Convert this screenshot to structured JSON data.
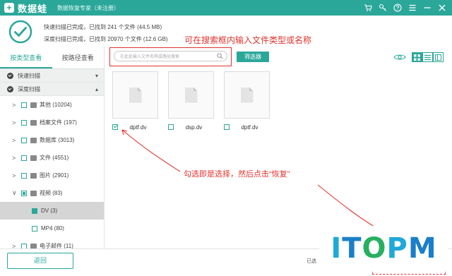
{
  "app": {
    "logo_text": "数据蛙",
    "subtitle": "数据恢复专家（未注册）"
  },
  "titlebar_icons": [
    "cart-icon",
    "key-icon",
    "help-icon",
    "menu-icon",
    "minimize-icon",
    "close-icon"
  ],
  "status": {
    "quick_scan": "快速扫描已完成，已找到 241 个文件 (44.5 MB)",
    "deep_scan": "深度扫描已完成，已找到 20970 个文件 (12.6 GB)"
  },
  "sidebar": {
    "tabs": [
      {
        "label": "按类型查看",
        "active": true
      },
      {
        "label": "按路径查看",
        "active": false
      }
    ],
    "groups": [
      {
        "label": "快速扫描",
        "chevron": "▾"
      },
      {
        "label": "深度扫描",
        "chevron": "▴"
      }
    ],
    "items": [
      {
        "label": "其他 (10204)",
        "arrow": ">"
      },
      {
        "label": "档案文件 (197)",
        "arrow": ">"
      },
      {
        "label": "数据库 (3013)",
        "arrow": ">"
      },
      {
        "label": "文件 (4551)",
        "arrow": ">"
      },
      {
        "label": "图片 (2901)",
        "arrow": ">"
      },
      {
        "label": "视频 (83)",
        "arrow": "∨"
      }
    ],
    "subitems": [
      {
        "label": "DV (3)",
        "selected": true
      },
      {
        "label": "MP4 (80)",
        "selected": false
      }
    ],
    "partial_item": {
      "label": "电子邮件 (11)",
      "arrow": ">"
    }
  },
  "search": {
    "placeholder": "在此处输入文件名称或路径搜索"
  },
  "toolbar": {
    "filter_label": "筛选器"
  },
  "files": [
    {
      "name": "dptf.dv",
      "checked": true
    },
    {
      "name": "dsp.dv",
      "checked": false
    },
    {
      "name": "dptf.dv",
      "checked": false
    }
  ],
  "annotations": {
    "search_tip": "可在搜索框内输入文件类型或名称",
    "select_tip": "勾选即是选择，然后点击“恢复”"
  },
  "bottom": {
    "back_label": "返回",
    "selected_prefix": "已选"
  },
  "watermark": {
    "letters": [
      "I",
      "T",
      "O",
      "P",
      "M"
    ]
  },
  "colors": {
    "accent": "#2ba79a",
    "annotation": "#e0332c"
  }
}
